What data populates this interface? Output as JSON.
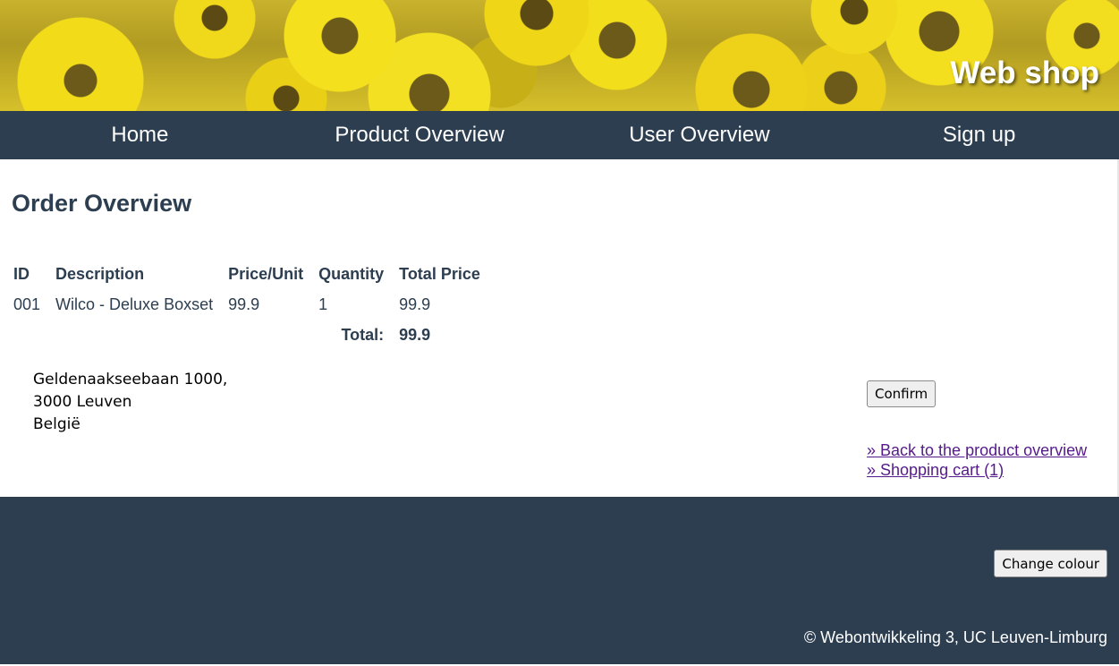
{
  "header": {
    "site_title": "Web shop"
  },
  "nav": {
    "items": [
      {
        "label": "Home"
      },
      {
        "label": "Product Overview"
      },
      {
        "label": "User Overview"
      },
      {
        "label": "Sign up"
      }
    ]
  },
  "main": {
    "title": "Order Overview",
    "table": {
      "headers": [
        "ID",
        "Description",
        "Price/Unit",
        "Quantity",
        "Total Price"
      ],
      "rows": [
        {
          "id": "001",
          "description": "Wilco - Deluxe Boxset",
          "price_unit": "99.9",
          "quantity": "1",
          "total_price": "99.9"
        }
      ],
      "total_label": "Total:",
      "total_value": "99.9"
    },
    "address": {
      "line1": "Geldenaakseebaan 1000,",
      "line2": "3000 Leuven",
      "line3": "België"
    },
    "confirm_label": "Confirm",
    "links": {
      "back": "» Back to the product overview",
      "cart": "» Shopping cart (1)"
    }
  },
  "footer": {
    "change_colour_label": "Change colour",
    "copyright": "© Webontwikkeling 3, UC Leuven-Limburg"
  },
  "colors": {
    "nav_background": "#2c3e50",
    "link_visited": "#551a8b",
    "banner_yellow": "#f2dc1a"
  }
}
